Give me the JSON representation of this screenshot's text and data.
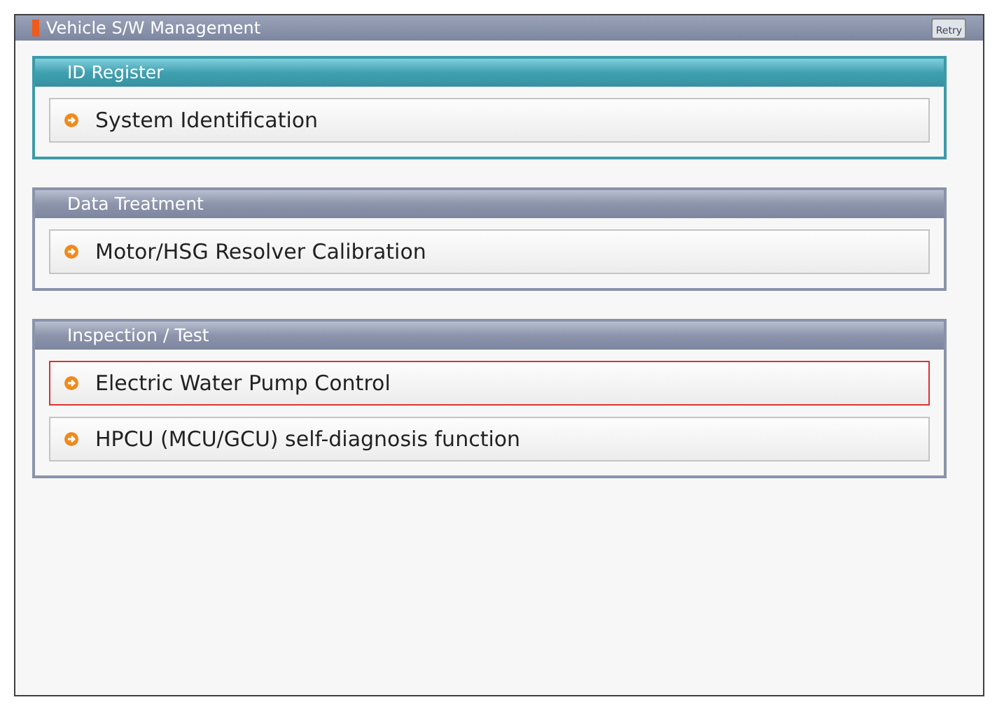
{
  "window": {
    "title": "Vehicle S/W Management",
    "retry_button": "Retry"
  },
  "sections": [
    {
      "title": "ID Register",
      "active": true,
      "items": [
        {
          "label": "System Identification",
          "selected": false
        }
      ]
    },
    {
      "title": "Data Treatment",
      "active": false,
      "items": [
        {
          "label": "Motor/HSG Resolver Calibration",
          "selected": false
        }
      ]
    },
    {
      "title": "Inspection / Test",
      "active": false,
      "items": [
        {
          "label": "Electric Water Pump Control",
          "selected": true
        },
        {
          "label": "HPCU (MCU/GCU) self-diagnosis function",
          "selected": false
        }
      ]
    }
  ]
}
